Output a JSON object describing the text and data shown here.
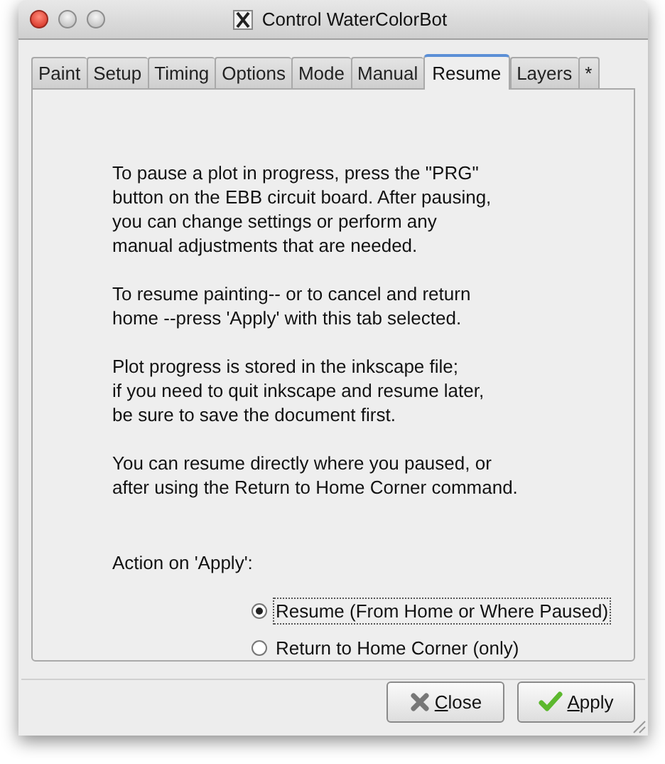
{
  "window": {
    "title": "Control WaterColorBot"
  },
  "tabs": [
    {
      "label": "Paint",
      "selected": false
    },
    {
      "label": "Setup",
      "selected": false
    },
    {
      "label": "Timing",
      "selected": false
    },
    {
      "label": "Options",
      "selected": false
    },
    {
      "label": "Mode",
      "selected": false
    },
    {
      "label": "Manual",
      "selected": false
    },
    {
      "label": "Resume",
      "selected": true
    },
    {
      "label": "Layers",
      "selected": false
    },
    {
      "label": "*",
      "selected": false
    }
  ],
  "paragraphs": [
    "To pause a plot in progress, press the \"PRG\"\nbutton on the EBB circuit board. After pausing,\nyou can change settings or perform any\nmanual adjustments that are needed.",
    "To resume painting-- or to cancel and return\nhome --press 'Apply' with this tab selected.",
    "Plot progress is stored in the inkscape file;\nif you need to quit inkscape and resume later,\nbe sure to save the document first.",
    "You can resume directly where you paused, or\nafter using the Return to Home Corner command."
  ],
  "action_label": "Action on 'Apply':",
  "options": [
    {
      "label": "Resume (From Home or Where Paused)",
      "selected": true
    },
    {
      "label": "Return to Home Corner (only)",
      "selected": false
    }
  ],
  "buttons": [
    {
      "kind": "close",
      "label": "Close"
    },
    {
      "kind": "apply",
      "label": "Apply"
    }
  ]
}
